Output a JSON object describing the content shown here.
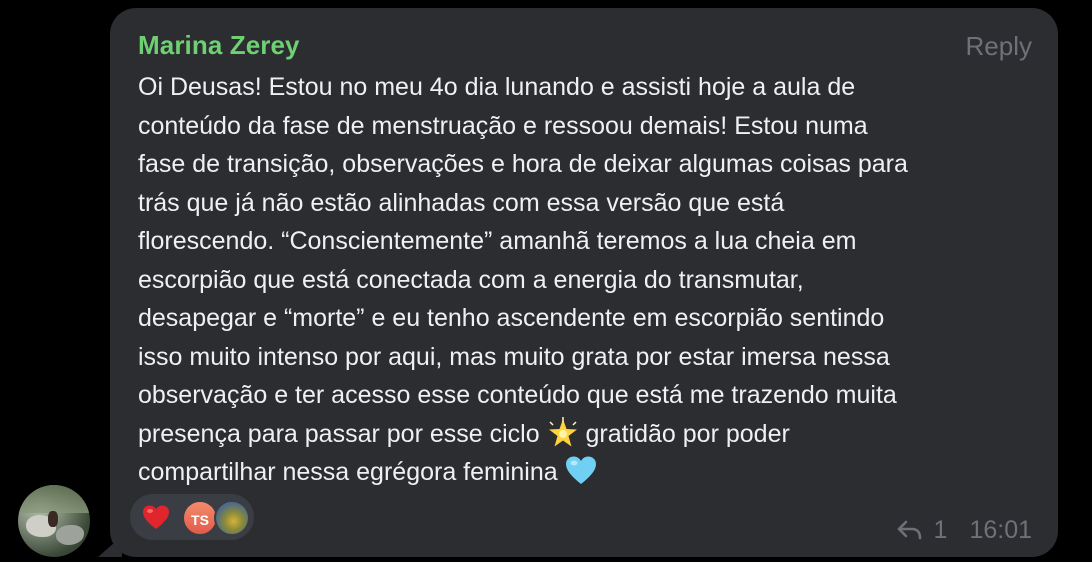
{
  "sender": {
    "name": "Marina Zerey",
    "color": "#6fcf73"
  },
  "header": {
    "reply_label": "Reply"
  },
  "message": {
    "text_before_star": "Oi Deusas! Estou no meu 4o dia lunando e assisti hoje a aula de\nconteúdo da fase de menstruação e ressoou demais! Estou numa\nfase de transição, observações e hora de deixar algumas coisas para\ntrás que já não estão alinhadas com essa versão que está\nflorescendo. “Conscientemente” amanhã teremos a lua cheia em\nescorpião que está conectada com a energia do transmutar,\ndesapegar e “morte” e eu tenho ascendente em escorpião sentindo\nisso muito intenso por aqui, mas muito grata por estar imersa nessa\nobservação e ter acesso esse conteúdo que está me trazendo muita\npresença para passar por esse ciclo ",
    "text_after_star": " gratidão por poder\ncompartilhar nessa egrégora feminina ",
    "emoji_1": "glowing-star-icon",
    "emoji_2": "light-blue-heart-icon"
  },
  "reactions": {
    "emoji": "red-heart-icon",
    "reactor_initials": "TS",
    "reactor_initials_color": "#e8664f"
  },
  "meta": {
    "reply_count": "1",
    "time": "16:01"
  },
  "colors": {
    "background": "#000000",
    "bubble": "#2b2d31",
    "text": "#eef0f2",
    "muted": "#6e7177"
  }
}
